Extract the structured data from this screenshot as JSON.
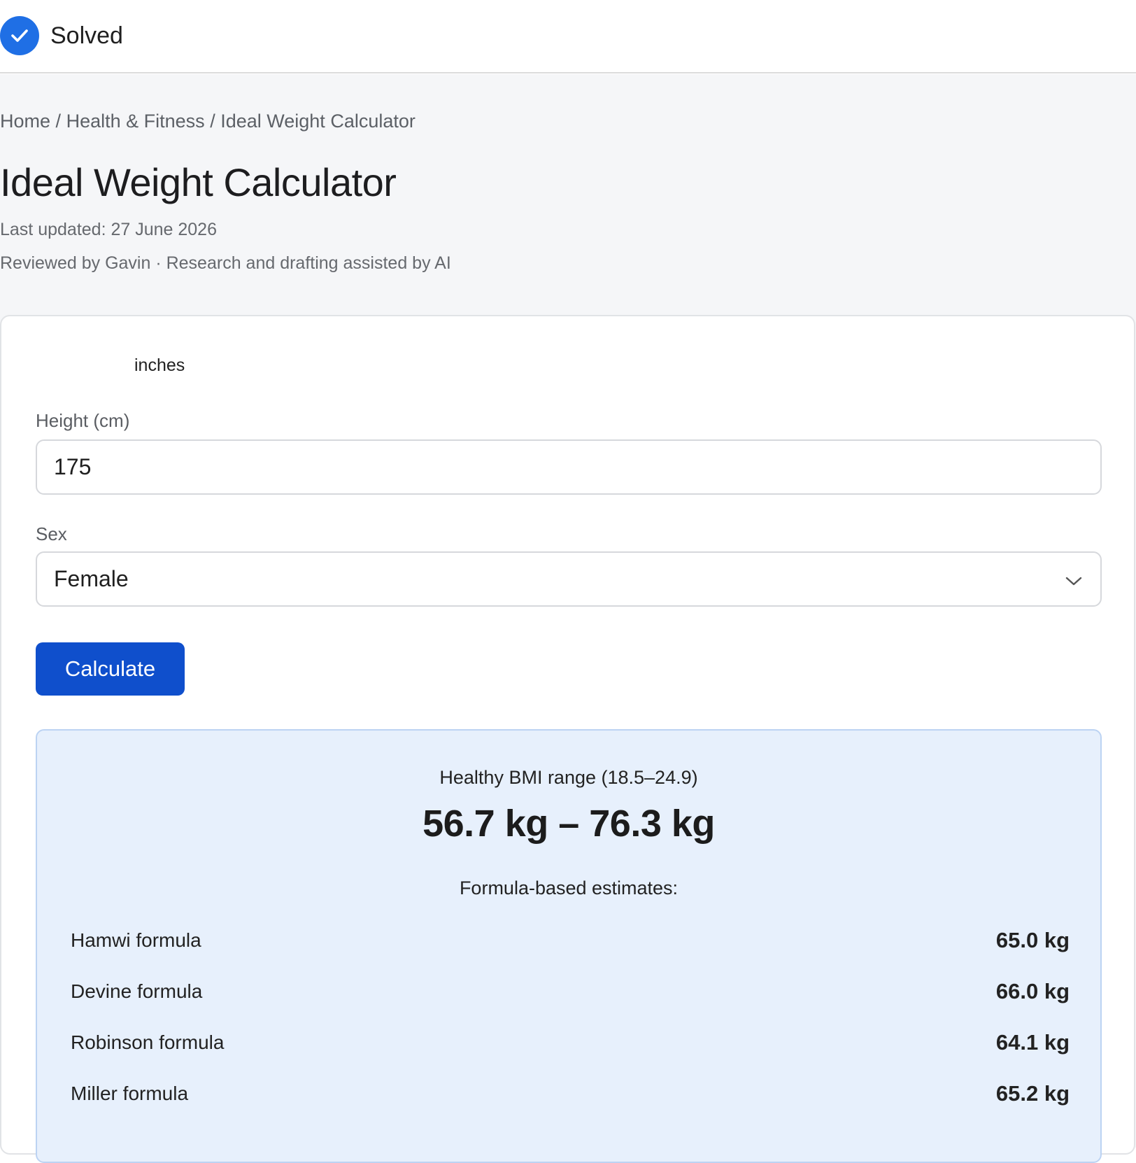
{
  "status": {
    "icon": "checkmark-circle-icon",
    "label": "Solved",
    "accent_color": "#1f6fe5"
  },
  "breadcrumb": {
    "items": [
      "Home",
      "Health & Fitness",
      "Ideal Weight Calculator"
    ],
    "separator": "/"
  },
  "page": {
    "title": "Ideal Weight Calculator",
    "last_updated": "Last updated: 27 June 2026",
    "reviewed": "Reviewed by Gavin · Research and drafting assisted by AI"
  },
  "form": {
    "unit_option_label": "inches",
    "height": {
      "label": "Height (cm)",
      "value": "175"
    },
    "sex": {
      "label": "Sex",
      "selected": "Female"
    },
    "calculate_label": "Calculate",
    "button_color": "#0f4fcc"
  },
  "results": {
    "range_caption": "Healthy BMI range (18.5–24.9)",
    "range_value": "56.7 kg – 76.3 kg",
    "estimates_caption": "Formula-based estimates:",
    "formulas": [
      {
        "name": "Hamwi formula",
        "value": "65.0 kg"
      },
      {
        "name": "Devine formula",
        "value": "66.0 kg"
      },
      {
        "name": "Robinson formula",
        "value": "64.1 kg"
      },
      {
        "name": "Miller formula",
        "value": "65.2 kg"
      }
    ],
    "background_color": "#e7f0fc"
  }
}
